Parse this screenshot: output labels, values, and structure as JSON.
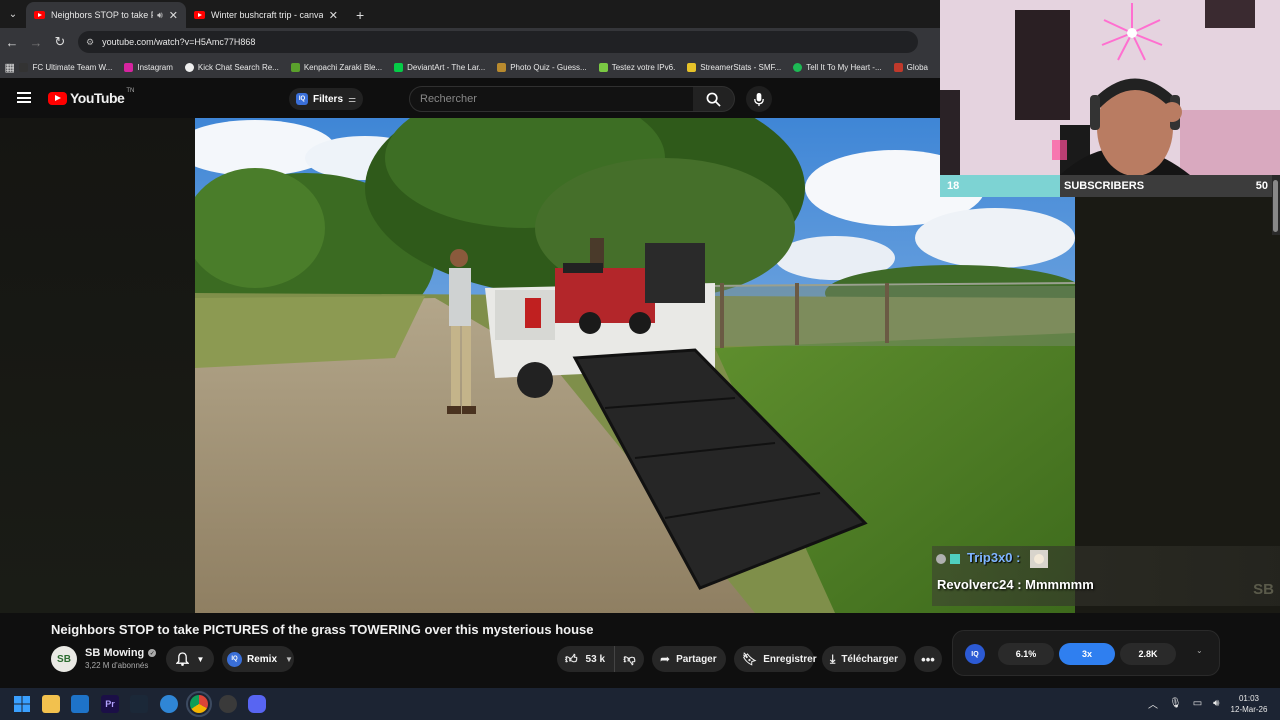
{
  "browser": {
    "tabs": [
      {
        "title": "Neighbors STOP to take PI",
        "active": true
      },
      {
        "title": "Winter bushcraft trip - canvas l",
        "active": false
      }
    ],
    "url": "youtube.com/watch?v=H5Amc77H868",
    "bookmarks": [
      {
        "label": "FC Ultimate Team W...",
        "color": "#333333"
      },
      {
        "label": "Instagram",
        "color": "#d6249f"
      },
      {
        "label": "Kick Chat Search Re...",
        "color": "#eeeeee"
      },
      {
        "label": "Kenpachi Zaraki Ble...",
        "color": "#5aa02c"
      },
      {
        "label": "DeviantArt - The Lar...",
        "color": "#05cc47"
      },
      {
        "label": "Photo Quiz - Guess...",
        "color": "#b88a2e"
      },
      {
        "label": "Testez votre IPv6.",
        "color": "#7ac943"
      },
      {
        "label": "StreamerStats - SMF...",
        "color": "#e6c229"
      },
      {
        "label": "Tell It To My Heart -...",
        "color": "#1db954"
      },
      {
        "label": "Globa",
        "color": "#c0392b"
      }
    ]
  },
  "youtube": {
    "logo_text": "YouTube",
    "country_code": "TN",
    "filters_label": "Filters",
    "search_placeholder": "Rechercher"
  },
  "video": {
    "title": "Neighbors STOP to take PICTURES of the grass TOWERING over this mysterious house",
    "channel": "SB Mowing",
    "channel_initials": "SB",
    "subscribers": "3,22 M d'abonnés",
    "remix_label": "Remix",
    "likes": "53 k",
    "share_label": "Partager",
    "save_label": "Enregistrer",
    "download_label": "Télécharger"
  },
  "stream_overlay": {
    "sub_current": "18",
    "sub_label": "SUBSCRIBERS",
    "sub_goal": "50",
    "sub_progress": 0.36,
    "chat_user": "Trip3x0 :",
    "chat_line": "Revolverc24 : Mmmmmm",
    "watermark": "SB"
  },
  "extension": {
    "logo": "IQ",
    "percent": "6.1%",
    "multiplier": "3x",
    "count": "2.8K"
  },
  "taskbar": {
    "time": "01:03",
    "date": "12-Mar-26"
  }
}
